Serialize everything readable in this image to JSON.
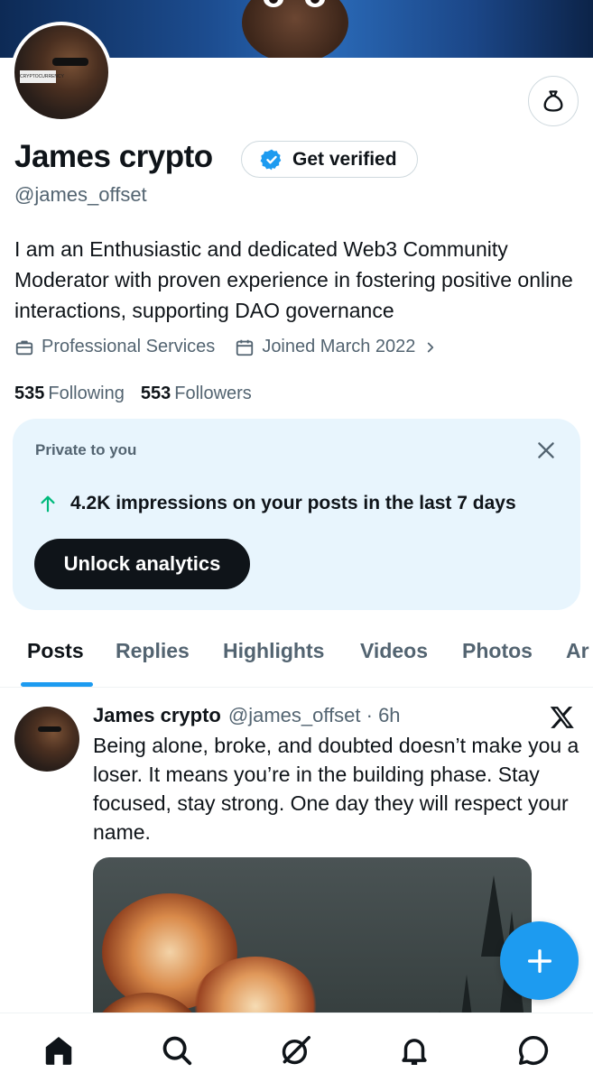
{
  "profile": {
    "name": "James crypto",
    "handle": "@james_offset",
    "verify_label": "Get verified",
    "bio": "I am an Enthusiastic and dedicated Web3 Community Moderator with proven experience in fostering positive online interactions, supporting DAO governance",
    "category": "Professional Services",
    "joined": "Joined March 2022",
    "following_count": "535",
    "following_label": "Following",
    "followers_count": "553",
    "followers_label": "Followers",
    "avatar_sign_text": "CRYPTOCURRENCY"
  },
  "private_card": {
    "label": "Private to you",
    "impressions_text": "4.2K impressions on your posts in the last 7 days",
    "unlock_label": "Unlock analytics"
  },
  "tabs": [
    {
      "label": "Posts",
      "active": true
    },
    {
      "label": "Replies",
      "active": false
    },
    {
      "label": "Highlights",
      "active": false
    },
    {
      "label": "Videos",
      "active": false
    },
    {
      "label": "Photos",
      "active": false
    },
    {
      "label": "Ar",
      "active": false
    }
  ],
  "post": {
    "author": "James crypto",
    "handle_time": "@james_offset · 6h",
    "text": "Being alone, broke, and doubted doesn’t make you a loser. It means you’re in the building phase. Stay focused, stay strong. One day they will respect your name."
  },
  "colors": {
    "accent": "#1d9bf0",
    "text": "#0f1419",
    "secondary": "#536471",
    "card_bg": "#e8f5fd",
    "up_arrow": "#00ba7c"
  },
  "icons": {
    "bag": "money-bag-icon",
    "verified": "verified-badge-icon",
    "briefcase": "briefcase-icon",
    "calendar": "calendar-icon",
    "close": "close-icon",
    "arrow_up": "arrow-up-icon",
    "x_logo": "x-logo-icon",
    "compose": "plus-icon",
    "nav": [
      "home-icon",
      "search-icon",
      "grok-icon",
      "bell-icon",
      "messages-icon"
    ]
  }
}
